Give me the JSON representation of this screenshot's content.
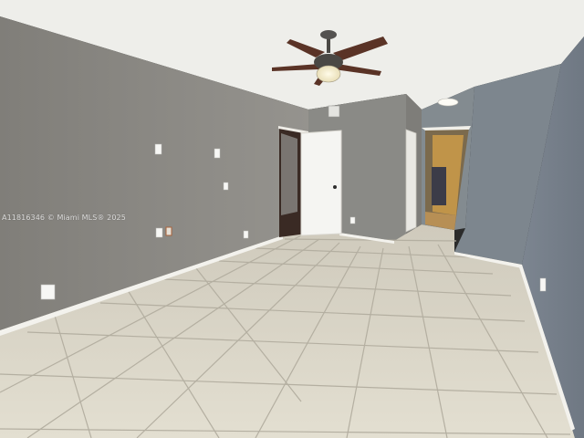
{
  "photo": {
    "subject": "vacant-bedroom-interior",
    "watermark": "A11816346 © Miami MLS® 2025"
  },
  "colors": {
    "ceiling": "#efefec",
    "wall_left": "#8c8a85",
    "wall_back": "#888884",
    "wall_right": "#7f8890",
    "floor_tile": "#ddd9cb",
    "grout": "#b9b4a6",
    "baseboard": "#f4f3ee",
    "door": "#f7f7f4",
    "fan_blade": "#5a3326",
    "fan_metal": "#4a4844"
  }
}
